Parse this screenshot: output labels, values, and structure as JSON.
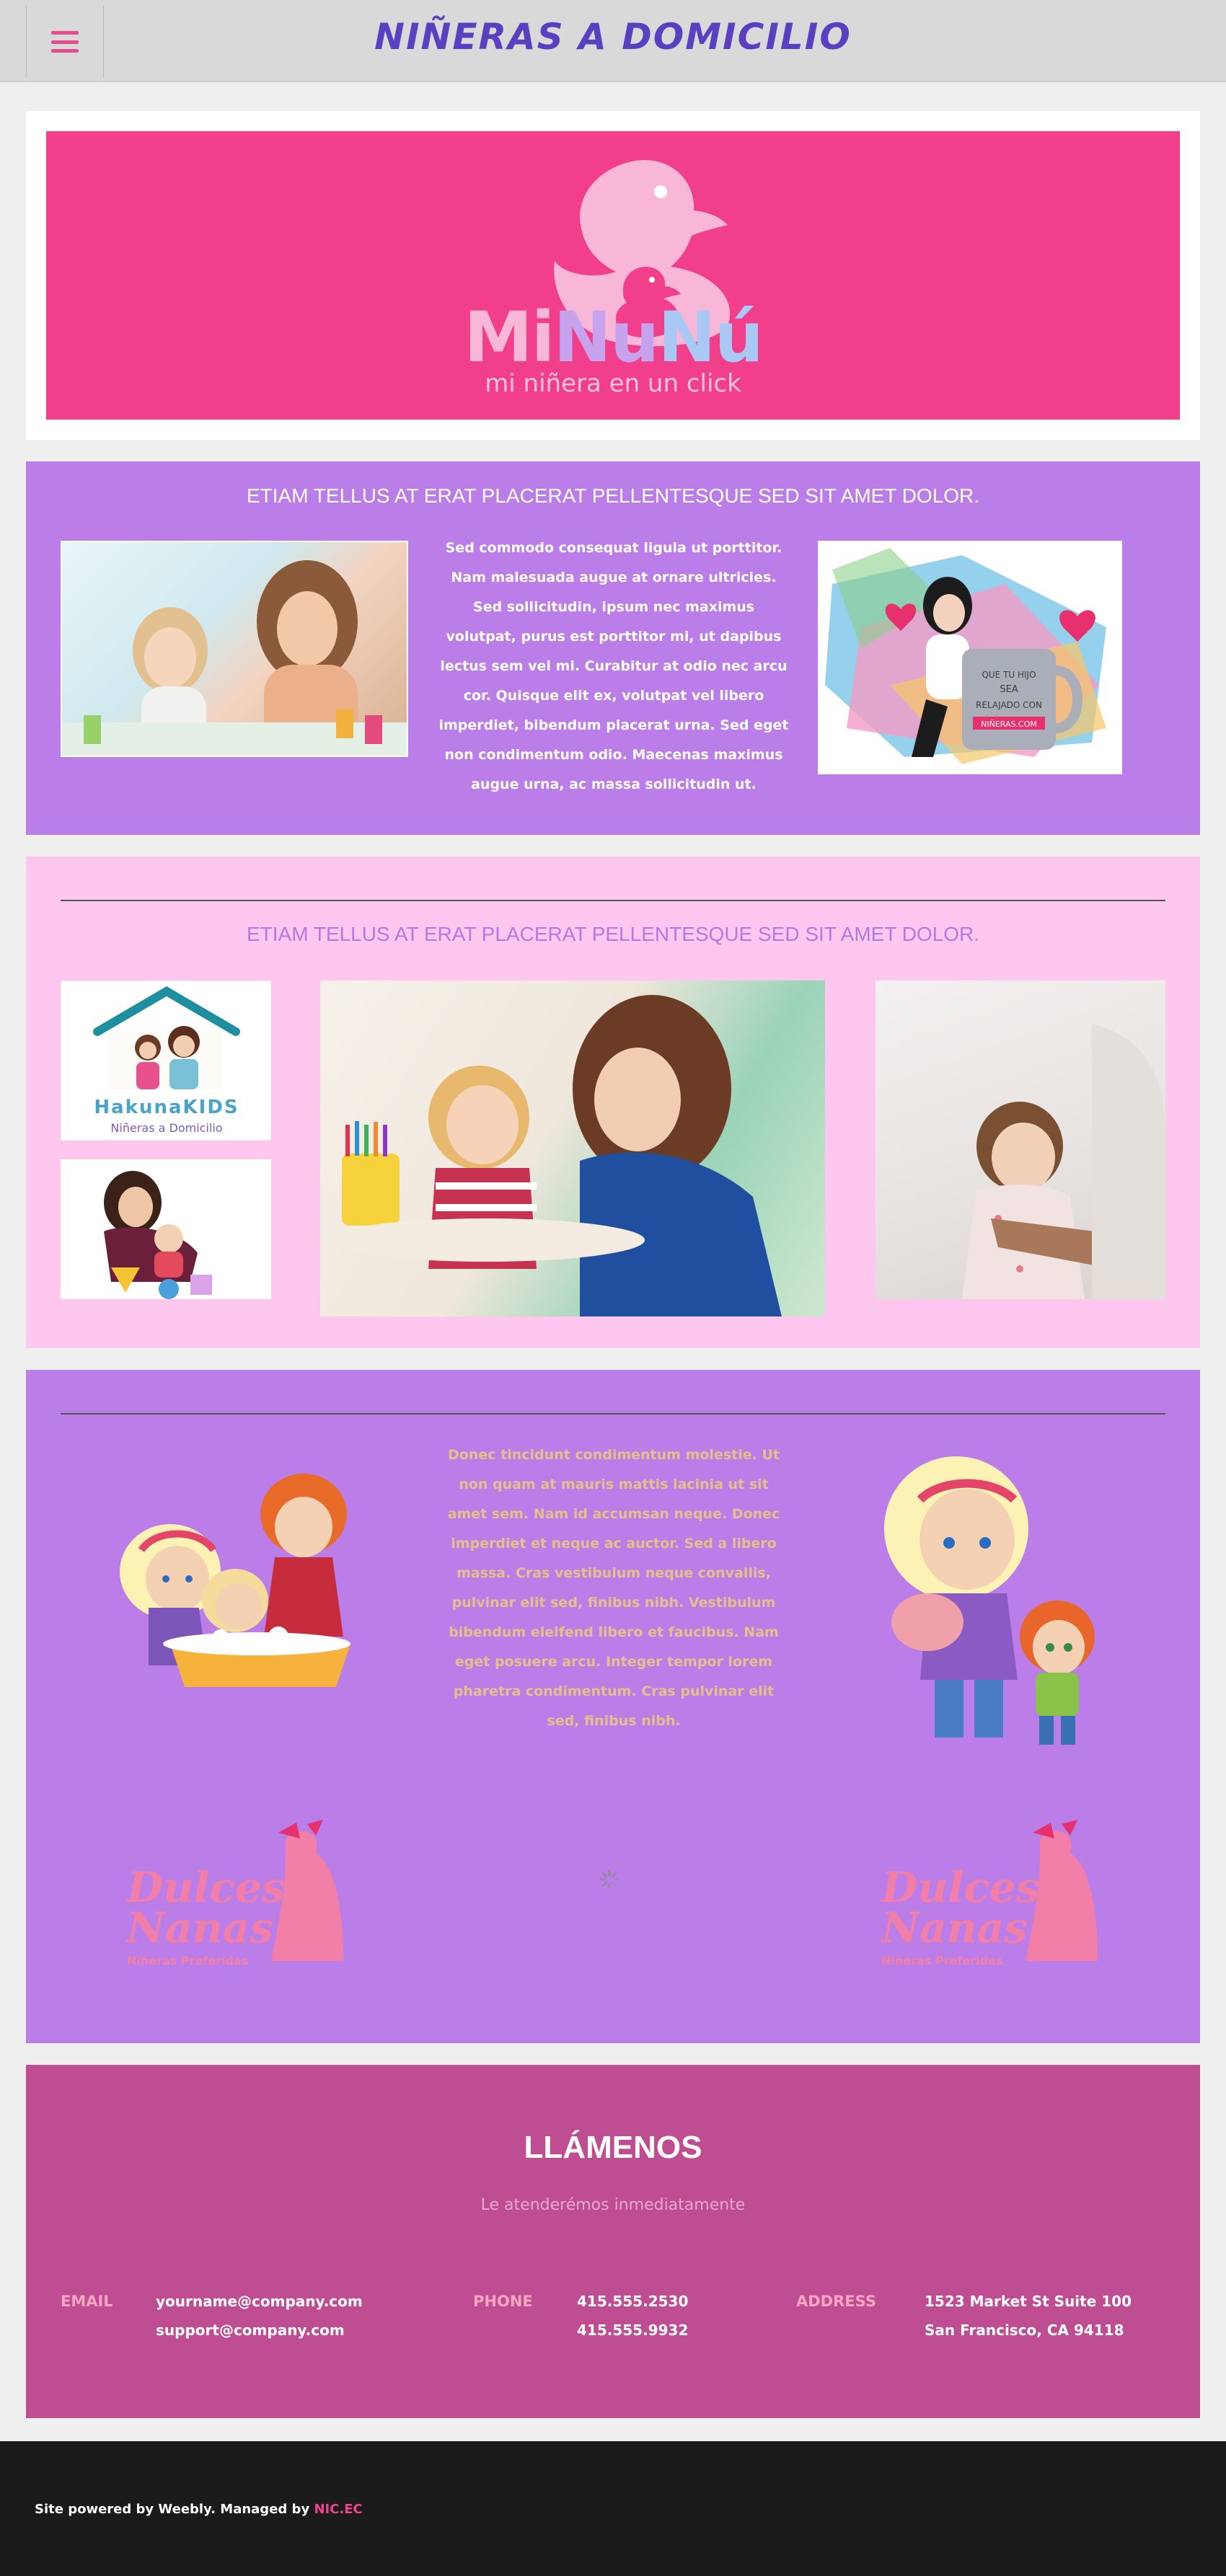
{
  "header": {
    "title": "NIÑERAS A DOMICILIO",
    "menu_icon": "hamburger-icon"
  },
  "banner": {
    "logo_word_1": "Mi",
    "logo_word_2": "Nu",
    "logo_word_3": "Nú",
    "tagline": "mi niñera en un click"
  },
  "section1": {
    "heading": "ETIAM TELLUS AT ERAT PLACERAT PELLENTESQUE SED SIT AMET DOLOR.",
    "body": "Sed commodo consequat ligula ut porttitor. Nam malesuada augue at ornare ultricies. Sed sollicitudin, ipsum nec maximus volutpat, purus est porttitor mi, ut dapibus lectus sem vel mi. Curabitur at odio nec arcu cor. Quisque elit ex, volutpat vel libero imperdiet, bibendum placerat urna. Sed eget  non condimentum odio. Maecenas maximus augue urna, ac  massa sollicitudin ut.",
    "mug_text_1": "QUE TU HIJO",
    "mug_text_2": "SEA",
    "mug_text_3": "RELAJADO CON",
    "mug_text_4": "NIÑERAS.COM"
  },
  "section2": {
    "heading": "ETIAM TELLUS AT ERAT PLACERAT PELLENTESQUE SED SIT AMET DOLOR.",
    "kakuna_title": "HakunaKIDS",
    "kakuna_sub": "Niñeras a Domicilio"
  },
  "section3": {
    "body": "Donec tincidunt condimentum molestie. Ut non quam at mauris mattis lacinia ut sit amet sem. Nam id accumsan neque. Donec imperdiet et neque ac auctor. Sed a libero massa. Cras vestibulum neque convallis, pulvinar elit sed, finibus nibh. Vestibulum bibendum eleifend libero et faucibus. Nam eget posuere arcu. Integer tempor lorem  pharetra condimentum. Cras  pulvinar elit sed, finibus nibh.",
    "logo_left_line1": "Dulces",
    "logo_left_line2": "Nanas",
    "logo_left_sub": "Niñeras Preferidas",
    "logo_right_line1": "Dulces",
    "logo_right_line2": "Nanas",
    "logo_right_sub": "Niñeras Preferidas"
  },
  "contact": {
    "title": "LLÁMENOS",
    "subtitle": "Le atenderémos inmediatamente",
    "email_label": "EMAIL",
    "email_1": "yourname@company.com",
    "email_2": "support@company.com",
    "phone_label": "PHONE",
    "phone_1": "415.555.2530",
    "phone_2": "415.555.9932",
    "address_label": "ADDRESS",
    "address_1": "1523 Market St  Suite 100",
    "address_2": "San Francisco, CA 94118"
  },
  "footer": {
    "text": "Site powered by Weebly. Managed by ",
    "link": "NIC.EC"
  },
  "colors": {
    "header_bg": "#d9d9d9",
    "title": "#5a3fc0",
    "pink": "#f23f8c",
    "purple": "#bb7de8",
    "light_pink": "#fdc7ef",
    "magenta": "#bf4d91",
    "footer": "#1b1b1b"
  }
}
